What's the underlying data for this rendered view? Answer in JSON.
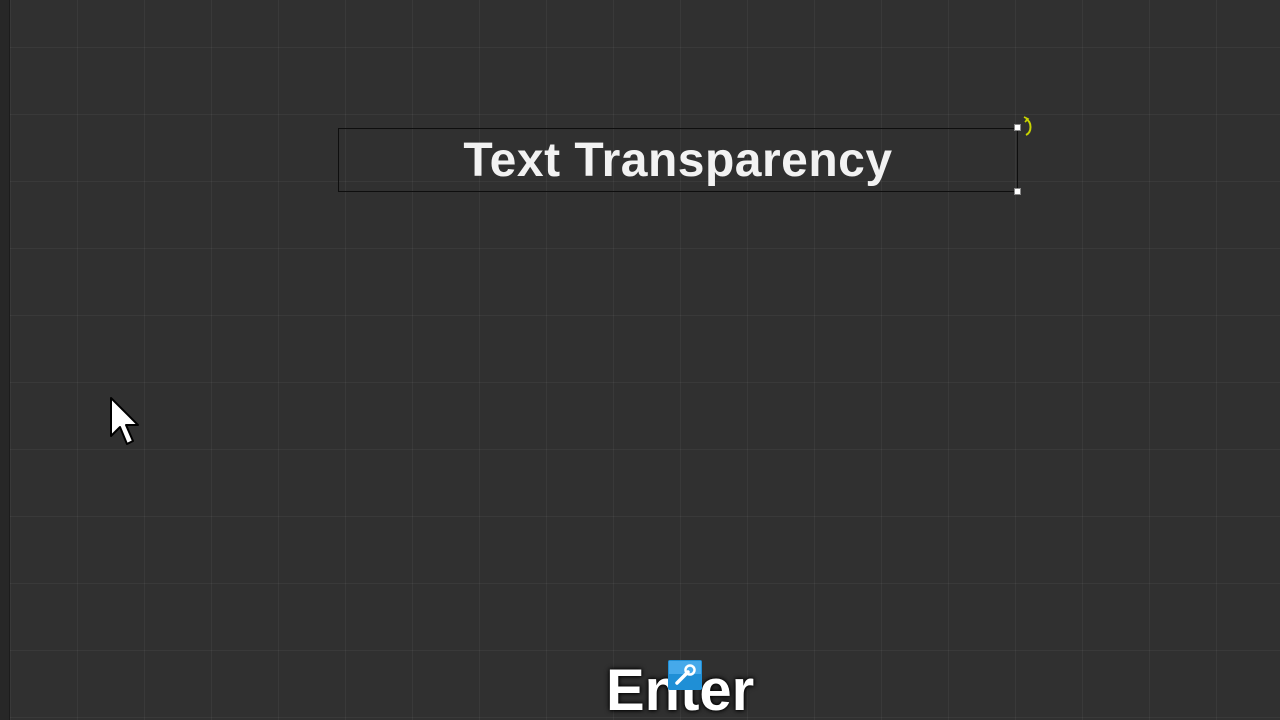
{
  "canvas": {
    "background_color": "#303030",
    "grid": true,
    "grid_line_color": "rgba(255,255,255,0.045)"
  },
  "text_box": {
    "text": "Text Transparency",
    "text_color": "#f2f2f2",
    "selected": true,
    "handles": [
      "top-right",
      "bottom-right"
    ],
    "rotate_handle_color": "#c8d400"
  },
  "cursor": {
    "icon": "arrow-pointer-icon"
  },
  "key_overlay": {
    "label": "Enter",
    "icon": "wrench-tool-icon",
    "icon_color": "#1f8fd6"
  }
}
